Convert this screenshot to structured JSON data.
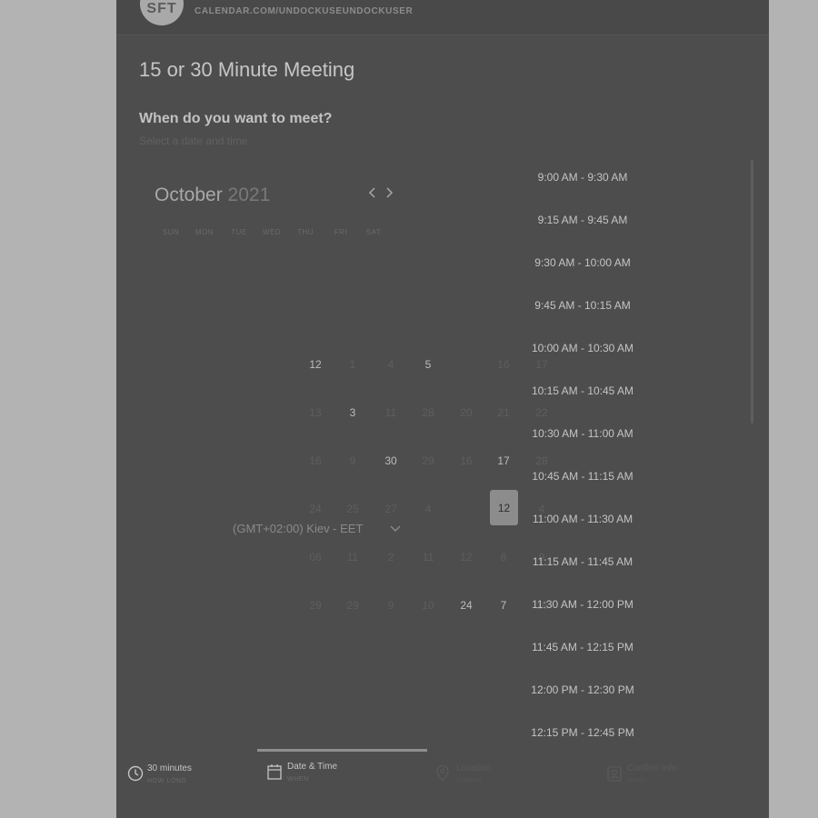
{
  "header": {
    "avatar_initials": "SFT",
    "url": "CALENDAR.COM/UNDOCKUSEUNDOCKUSER"
  },
  "event": {
    "title": "15 or 30 Minute Meeting",
    "question": "When do you want to meet?",
    "hint": "Select a date and time"
  },
  "calendar": {
    "month": "October",
    "year": "2021",
    "weekdays": [
      "SUN",
      "MON",
      "TUE",
      "WED",
      "THU",
      "FRI",
      "SAT"
    ],
    "rows": [
      [
        "12",
        "1",
        "4",
        "5",
        "",
        "16",
        "17"
      ],
      [
        "13",
        "3",
        "11",
        "28",
        "20",
        "21",
        "22"
      ],
      [
        "16",
        "9",
        "30",
        "29",
        "16",
        "17",
        "28"
      ],
      [
        "24",
        "25",
        "27",
        "4",
        "",
        "12",
        "4"
      ],
      [
        "06",
        "11",
        "2",
        "11",
        "12",
        "8",
        "9"
      ],
      [
        "29",
        "29",
        "9",
        "10",
        "24",
        "7",
        "18"
      ]
    ],
    "available": [
      "12",
      "5",
      "3",
      "30",
      "17",
      "24",
      "7"
    ],
    "selected": "12"
  },
  "timezone": {
    "label": "(GMT+02:00) Kiev - EET"
  },
  "slots": [
    "9:00 AM - 9:30 AM",
    "9:15 AM - 9:45 AM",
    "9:30 AM - 10:00 AM",
    "9:45 AM - 10:15 AM",
    "10:00 AM - 10:30 AM",
    "10:15 AM - 10:45 AM",
    "10:30 AM - 11:00 AM",
    "10:45 AM - 11:15 AM",
    "11:00 AM - 11:30 AM",
    "11:15 AM - 11:45 AM",
    "11:30 AM - 12:00 PM",
    "11:45 AM - 12:15 PM",
    "12:00 PM - 12:30 PM",
    "12:15 PM - 12:45 PM"
  ],
  "steps": [
    {
      "label": "30 minutes",
      "sub": "HOW LONG",
      "icon": "clock-icon"
    },
    {
      "label": "Date & Time",
      "sub": "WHEN",
      "icon": "calendar-icon"
    },
    {
      "label": "Location",
      "sub": "WHERE",
      "icon": "location-pin-icon"
    },
    {
      "label": "Confirm Info",
      "sub": "WHO",
      "icon": "person-card-icon"
    }
  ]
}
